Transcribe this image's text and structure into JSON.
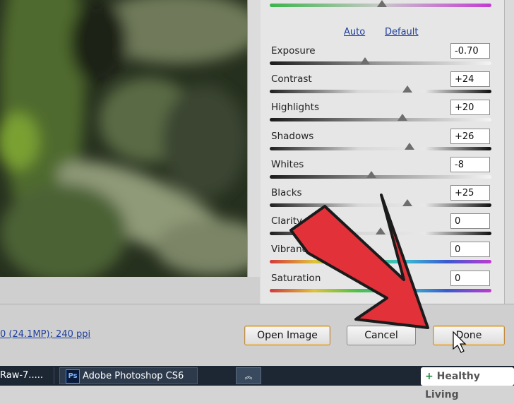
{
  "panel": {
    "auto_link": "Auto",
    "default_link": "Default",
    "adjustments": [
      {
        "label": "Exposure",
        "value": "-0.70",
        "level": 0.43,
        "track": "bw-dark"
      },
      {
        "label": "Contrast",
        "value": "+24",
        "level": 0.62,
        "track": "bw-light"
      },
      {
        "label": "Highlights",
        "value": "+20",
        "level": 0.6,
        "track": "bw-dark"
      },
      {
        "label": "Shadows",
        "value": "+26",
        "level": 0.63,
        "track": "bw-light"
      },
      {
        "label": "Whites",
        "value": "-8",
        "level": 0.46,
        "track": "bw-dark"
      },
      {
        "label": "Blacks",
        "value": "+25",
        "level": 0.62,
        "track": "bw-light"
      },
      {
        "label": "Clarity",
        "value": "0",
        "level": 0.5,
        "track": "bw-light"
      },
      {
        "label": "Vibrance",
        "value": "0",
        "level": 0.5,
        "track": "spectrum"
      },
      {
        "label": "Saturation",
        "value": "0",
        "level": 0.5,
        "track": "spectrum"
      }
    ]
  },
  "image_info": "0 (24.1MP); 240 ppi",
  "buttons": {
    "open_image": "Open Image",
    "cancel": "Cancel",
    "done": "Done"
  },
  "taskbar": {
    "item1": "Raw-7.....",
    "ps_icon": "Ps",
    "item2": "Adobe Photoshop CS6",
    "expand": "︽"
  },
  "watermark": {
    "plus": "+",
    "text": "Healthy Living"
  },
  "colors": {
    "arrow_fill": "#e23138",
    "accent_link": "#1f3f9c"
  }
}
